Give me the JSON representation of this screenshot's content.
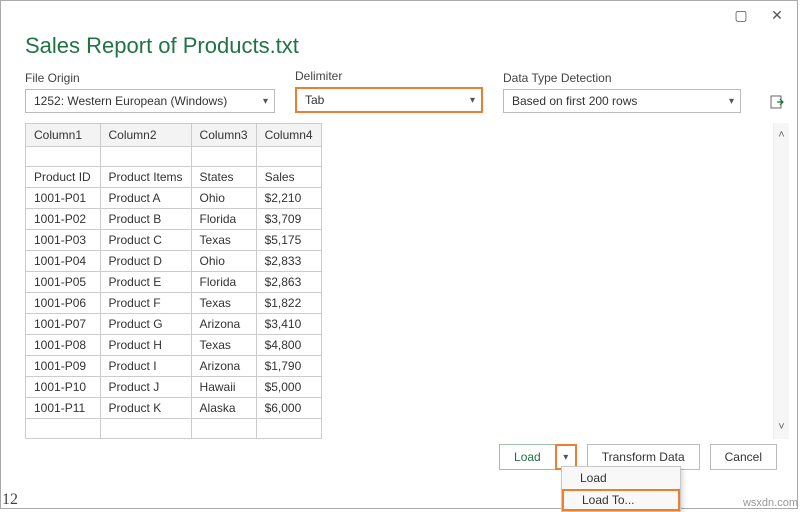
{
  "title": "Sales Report of Products.txt",
  "controls": {
    "origin": {
      "label": "File Origin",
      "value": "1252: Western European (Windows)"
    },
    "delimiter": {
      "label": "Delimiter",
      "value": "Tab"
    },
    "detection": {
      "label": "Data Type Detection",
      "value": "Based on first 200 rows"
    }
  },
  "columns": [
    "Column1",
    "Column2",
    "Column3",
    "Column4"
  ],
  "rows": [
    [
      "",
      "",
      "",
      ""
    ],
    [
      "Product ID",
      "Product Items",
      "States",
      "Sales"
    ],
    [
      "1001-P01",
      "Product A",
      "Ohio",
      "$2,210"
    ],
    [
      "1001-P02",
      "Product B",
      "Florida",
      "$3,709"
    ],
    [
      "1001-P03",
      "Product C",
      "Texas",
      "$5,175"
    ],
    [
      "1001-P04",
      "Product D",
      "Ohio",
      "$2,833"
    ],
    [
      "1001-P05",
      "Product E",
      "Florida",
      "$2,863"
    ],
    [
      "1001-P06",
      "Product F",
      "Texas",
      "$1,822"
    ],
    [
      "1001-P07",
      "Product G",
      "Arizona",
      "$3,410"
    ],
    [
      "1001-P08",
      "Product H",
      "Texas",
      "$4,800"
    ],
    [
      "1001-P09",
      "Product I",
      "Arizona",
      "$1,790"
    ],
    [
      "1001-P10",
      "Product J",
      "Hawaii",
      "$5,000"
    ],
    [
      "1001-P11",
      "Product K",
      "Alaska",
      "$6,000"
    ],
    [
      "",
      "",
      "",
      ""
    ]
  ],
  "buttons": {
    "load": "Load",
    "transform": "Transform Data",
    "cancel": "Cancel"
  },
  "menu": {
    "load": "Load",
    "load_to": "Load To..."
  },
  "status_num": "12",
  "brand": "wsxdn.com"
}
